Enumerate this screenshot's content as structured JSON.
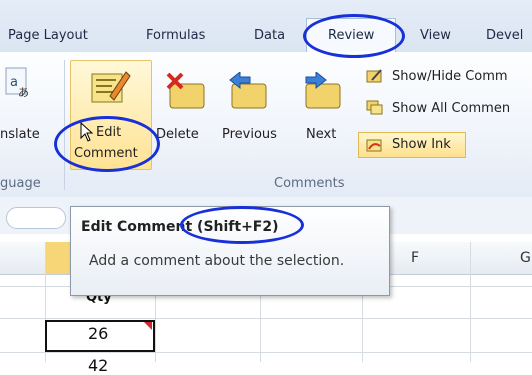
{
  "tabs": {
    "page_layout": "Page Layout",
    "formulas": "Formulas",
    "data": "Data",
    "review": "Review",
    "view": "View",
    "developer": "Devel"
  },
  "ribbon": {
    "translate_label": "nslate",
    "language_group": "guage",
    "comments_group": "Comments",
    "edit_comment_line1": "Edit",
    "edit_comment_line2": "Comment",
    "delete_label": "Delete",
    "previous_label": "Previous",
    "next_label": "Next",
    "show_hide_label": "Show/Hide Comm",
    "show_all_label": "Show All Commen",
    "show_ink_label": "Show Ink"
  },
  "tooltip": {
    "title": "Edit Comment (Shift+F2)",
    "body": "Add a comment about the selection."
  },
  "sheet": {
    "columns": [
      "F",
      "G"
    ],
    "partial_header": "Qty",
    "cells": [
      "26",
      "42"
    ]
  },
  "colors": {
    "annotation": "#1830d8",
    "selected_header": "#f6d676",
    "active_button": "#ffe394"
  }
}
